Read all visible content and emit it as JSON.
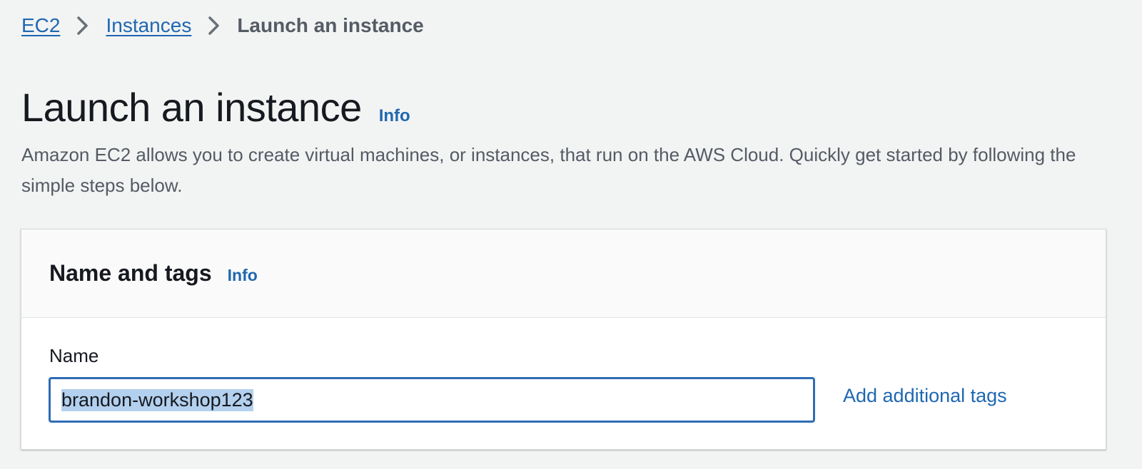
{
  "breadcrumb": {
    "items": [
      {
        "label": "EC2"
      },
      {
        "label": "Instances"
      }
    ],
    "current": "Launch an instance"
  },
  "header": {
    "title": "Launch an instance",
    "info_label": "Info",
    "description": "Amazon EC2 allows you to create virtual machines, or instances, that run on the AWS Cloud. Quickly get started by following the simple steps below."
  },
  "name_and_tags": {
    "title": "Name and tags",
    "info_label": "Info",
    "name_label": "Name",
    "name_value": "brandon-workshop123",
    "add_tags_label": "Add additional tags"
  },
  "colors": {
    "link": "#1f67b1",
    "focus_border": "#2e6cb5",
    "selection": "#b3d0ee",
    "page_bg": "#f2f3f3"
  }
}
